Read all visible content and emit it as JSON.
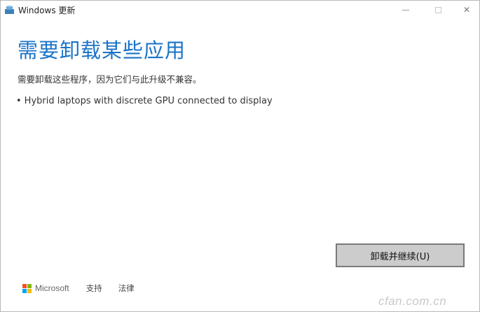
{
  "window": {
    "title": "Windows 更新",
    "icon": "windows-update-icon"
  },
  "titlebar_controls": {
    "minimize": "minimize-icon",
    "maximize": "maximize-icon",
    "close": "close-icon",
    "close_glyph": "✕"
  },
  "main": {
    "heading": "需要卸载某些应用",
    "subtitle": "需要卸载这些程序，因为它们与此升级不兼容。",
    "apps": [
      "Hybrid laptops with discrete GPU connected to display"
    ],
    "bullet": "•",
    "primary_button": "卸载并继续(U)"
  },
  "footer": {
    "brand": "Microsoft",
    "links": [
      "支持",
      "法律"
    ]
  },
  "watermark": "cfan.com.cn",
  "colors": {
    "accent": "#1a73c8",
    "ms_red": "#f25022",
    "ms_green": "#7fba00",
    "ms_blue": "#00a4ef",
    "ms_yellow": "#ffb900"
  }
}
